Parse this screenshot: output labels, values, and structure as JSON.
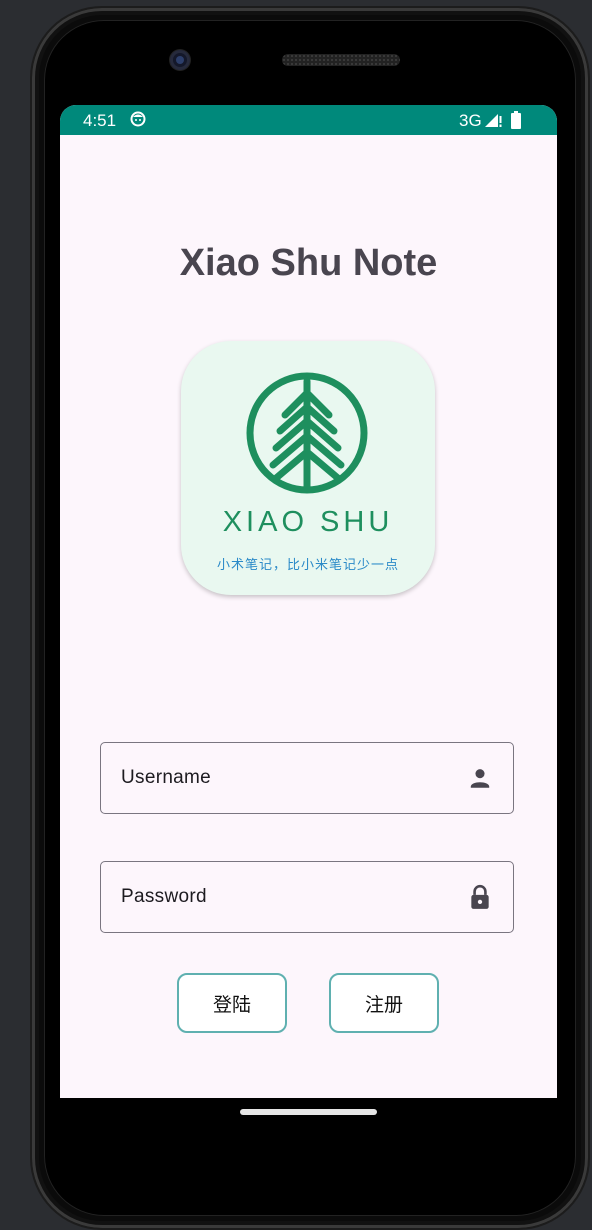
{
  "status_bar": {
    "time": "4:51",
    "network": "3G",
    "icons": [
      "face-icon",
      "signal-icon",
      "battery-icon"
    ]
  },
  "app": {
    "title": "Xiao Shu Note",
    "logo_brand": "XIAO SHU",
    "logo_slogan": "小术笔记，比小米笔记少一点"
  },
  "form": {
    "username": {
      "placeholder": "Username",
      "value": "",
      "icon": "person-icon"
    },
    "password": {
      "placeholder": "Password",
      "value": "",
      "icon": "lock-icon"
    },
    "login_label": "登陆",
    "register_label": "注册"
  },
  "colors": {
    "status_bar": "#00897b",
    "screen_bg": "#fdf6fc",
    "title": "#49454f",
    "logo_bg": "#e9f8f0",
    "logo_green": "#1e8f5e",
    "slogan_blue": "#2a8ac8",
    "button_border": "#5fb0b0"
  }
}
